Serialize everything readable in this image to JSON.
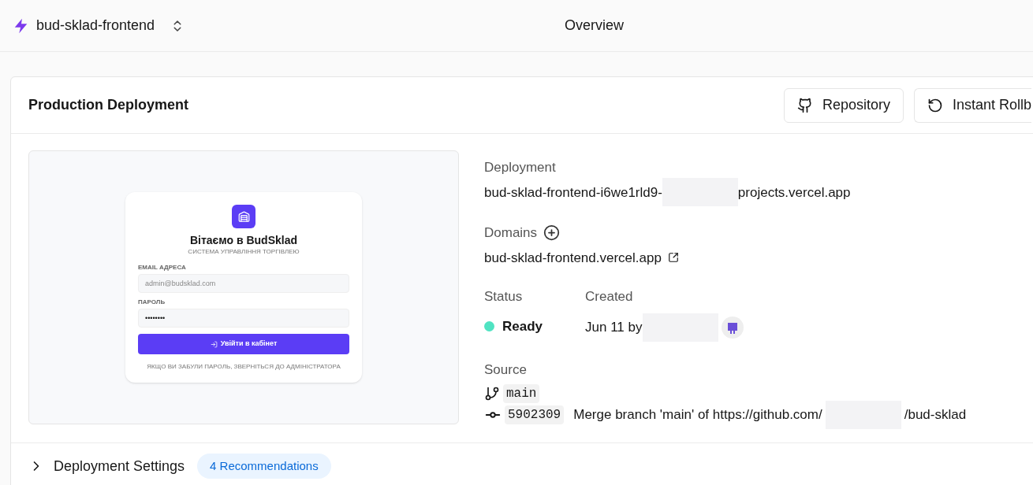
{
  "header": {
    "project": "bud-sklad-frontend",
    "title": "Overview"
  },
  "card": {
    "title": "Production Deployment",
    "buttons": [
      {
        "kind": "github",
        "label": "Repository"
      },
      {
        "kind": "rollback",
        "label": "Instant Rollb"
      }
    ]
  },
  "preview": {
    "heading": "Вітаємо в BudSklad",
    "subtitle": "СИСТЕМА УПРАВЛІННЯ ТОРГІВЛЕЮ",
    "email_label": "EMAIL АДРЕСА",
    "email_placeholder": "admin@budsklad.com",
    "password_label": "ПАРОЛЬ",
    "password_value": "••••••••",
    "submit": "Увійти в кабінет",
    "hint": "ЯКЩО ВИ ЗАБУЛИ ПАРОЛЬ, ЗВЕРНІТЬСЯ ДО АДМІНІСТРАТОРА"
  },
  "deployment": {
    "label": "Deployment",
    "url_start": "bud-sklad-frontend-i6we1rld9-",
    "url_end": "projects.vercel.app"
  },
  "domains": {
    "label": "Domains",
    "items": [
      "bud-sklad-frontend.vercel.app"
    ]
  },
  "status": {
    "label": "Status",
    "value": "Ready",
    "color": "#50e3c2"
  },
  "created": {
    "label": "Created",
    "value": "Jun 11 by"
  },
  "source": {
    "label": "Source",
    "branch": "main",
    "commit": "5902309",
    "message_start": "Merge branch 'main' of https://github.com/",
    "message_end": "/bud-sklad"
  },
  "settings": {
    "label": "Deployment Settings",
    "expanded": false,
    "badge": "4 Recommendations"
  }
}
